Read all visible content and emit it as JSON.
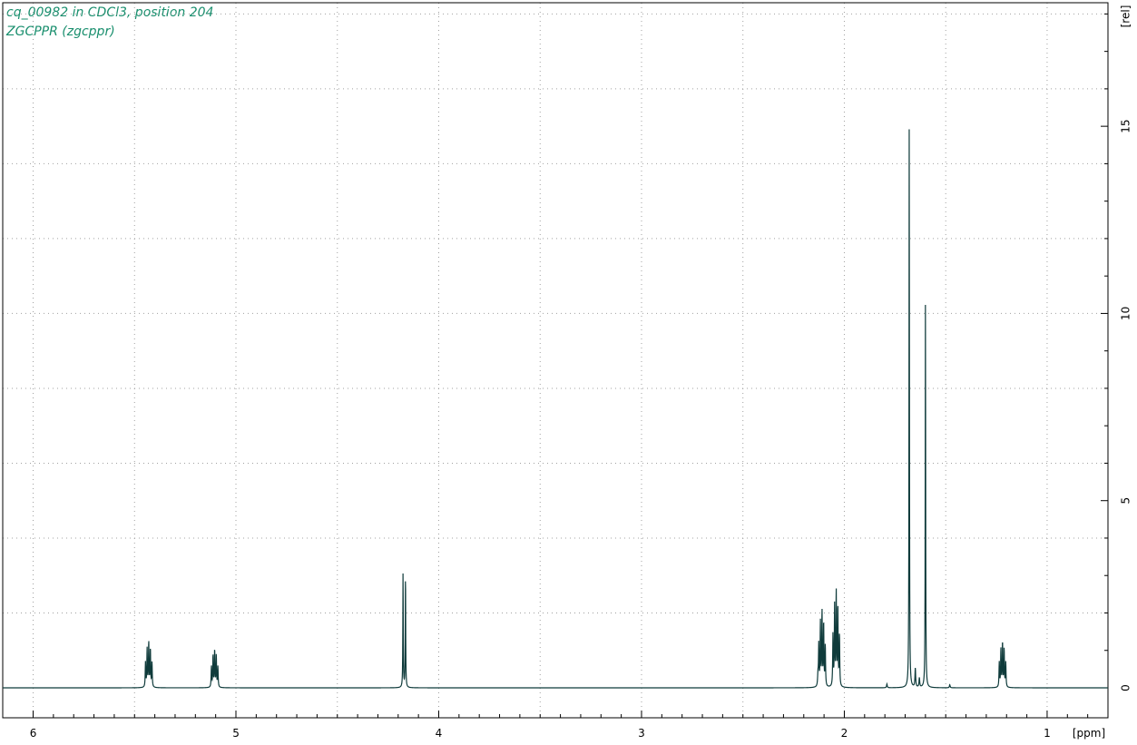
{
  "header": {
    "title_line1": "cq_00982 in CDCl3, position 204",
    "title_line2": "ZGCPPR (zgcppr)"
  },
  "colors": {
    "trace": "#0f3b3b",
    "title": "#1a8f6e",
    "axis": "#000000",
    "grid": "#a0a0a0"
  },
  "chart_data": {
    "type": "line",
    "title": "cq_00982 in CDCl3, position 204",
    "subtitle": "ZGCPPR (zgcppr)",
    "xlabel": "[ppm]",
    "ylabel": "[rel]",
    "x_reversed": true,
    "xlim": [
      6.15,
      0.7
    ],
    "ylim": [
      -0.8,
      18.3
    ],
    "grid": true,
    "x_ticks": [
      6,
      5,
      4,
      3,
      2,
      1
    ],
    "x_tick_labels": [
      "6",
      "5",
      "4",
      "3",
      "2",
      "1"
    ],
    "y_ticks": [
      0,
      5,
      10,
      15
    ],
    "y_tick_labels": [
      "0",
      "5",
      "10",
      "15"
    ],
    "peaks": [
      {
        "ppm": 5.43,
        "height": 1.2,
        "multiplet": "m"
      },
      {
        "ppm": 5.105,
        "height": 1.0,
        "multiplet": "m"
      },
      {
        "ppm": 4.17,
        "height": 3.1,
        "multiplet": "d"
      },
      {
        "ppm": 2.11,
        "height": 2.0,
        "multiplet": "m"
      },
      {
        "ppm": 2.04,
        "height": 2.5,
        "multiplet": "m"
      },
      {
        "ppm": 1.68,
        "height": 15.0,
        "multiplet": "s"
      },
      {
        "ppm": 1.6,
        "height": 10.4,
        "multiplet": "s"
      },
      {
        "ppm": 1.22,
        "height": 1.2,
        "multiplet": "m"
      }
    ]
  }
}
